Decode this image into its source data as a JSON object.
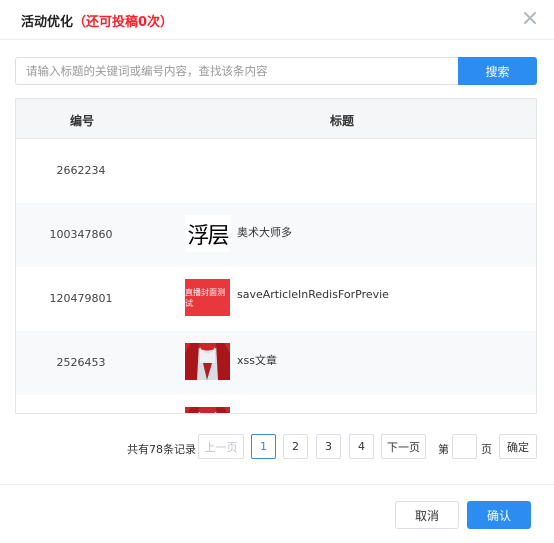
{
  "dialog": {
    "title": "活动优化",
    "subtitle": "（还可投稿0次）"
  },
  "search": {
    "placeholder": "请输入标题的关键词或编号内容，查找该条内容",
    "button_label": "搜索"
  },
  "table": {
    "headers": {
      "id": "编号",
      "title": "标题"
    },
    "rows": [
      {
        "id": "2662234",
        "title": "",
        "thumb": "none"
      },
      {
        "id": "100347860",
        "title": "奥术大师多",
        "thumb": "text",
        "thumb_text": "浮层"
      },
      {
        "id": "120479801",
        "title": "saveArticleInRedisForPrevie",
        "thumb": "red",
        "thumb_text": "直播封面测试"
      },
      {
        "id": "2526453",
        "title": "xss文章",
        "thumb": "photo"
      },
      {
        "id": "",
        "title": "",
        "thumb": "photo"
      }
    ]
  },
  "pagination": {
    "total_text": "共有78条记录",
    "prev_label": "上一页",
    "pages": [
      "1",
      "2",
      "3",
      "4"
    ],
    "current_page": "1",
    "next_label": "下一页",
    "jump_prefix": "第",
    "jump_suffix": "页",
    "confirm_label": "确定"
  },
  "footer": {
    "cancel_label": "取消",
    "ok_label": "确认"
  },
  "colors": {
    "primary": "#2d8cf0",
    "warning_text": "#f5222d",
    "thumb_red": "#e8383d"
  },
  "icons": {
    "close": "close-icon"
  }
}
